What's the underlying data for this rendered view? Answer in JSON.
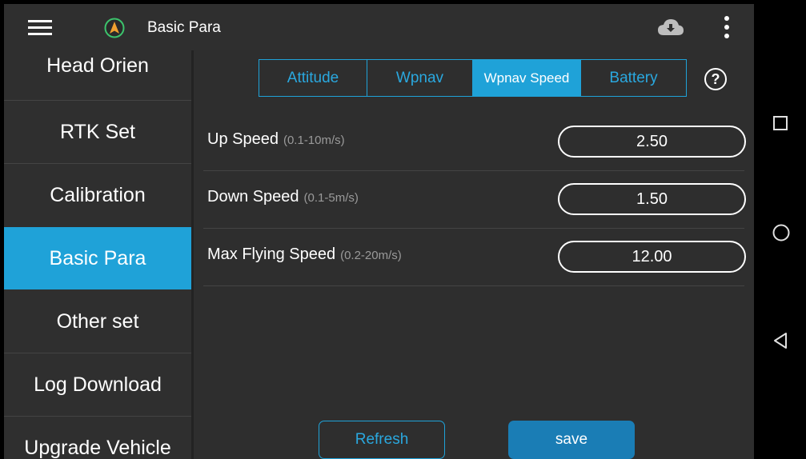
{
  "topbar": {
    "title": "Basic Para",
    "menu_icon": "hamburger-menu-icon",
    "logo_icon": "compass-logo-icon",
    "cloud_icon": "cloud-download-icon",
    "more_icon": "more-vertical-icon"
  },
  "sidebar": {
    "items": [
      {
        "label": "Head Orien",
        "active": false
      },
      {
        "label": "RTK Set",
        "active": false
      },
      {
        "label": "Calibration",
        "active": false
      },
      {
        "label": "Basic Para",
        "active": true
      },
      {
        "label": "Other set",
        "active": false
      },
      {
        "label": "Log Download",
        "active": false
      },
      {
        "label": "Upgrade Vehicle",
        "active": false
      }
    ]
  },
  "tabs": [
    {
      "label": "Attitude",
      "active": false
    },
    {
      "label": "Wpnav",
      "active": false
    },
    {
      "label": "Wpnav Speed",
      "active": true
    },
    {
      "label": "Battery",
      "active": false
    }
  ],
  "help_label": "?",
  "params": [
    {
      "label": "Up Speed",
      "range": "(0.1-10m/s)",
      "value": "2.50"
    },
    {
      "label": "Down Speed",
      "range": "(0.1-5m/s)",
      "value": "1.50"
    },
    {
      "label": "Max Flying Speed",
      "range": "(0.2-20m/s)",
      "value": "12.00"
    }
  ],
  "buttons": {
    "refresh": "Refresh",
    "save": "save"
  },
  "colors": {
    "accent": "#1fa2d8",
    "save": "#1a7db5",
    "background": "#2e2e2e",
    "logo": "#f0a030",
    "logo_ring": "#3cc36c"
  },
  "system_nav": {
    "icons": [
      "square-recent-apps-icon",
      "circle-home-icon",
      "triangle-back-icon"
    ]
  }
}
